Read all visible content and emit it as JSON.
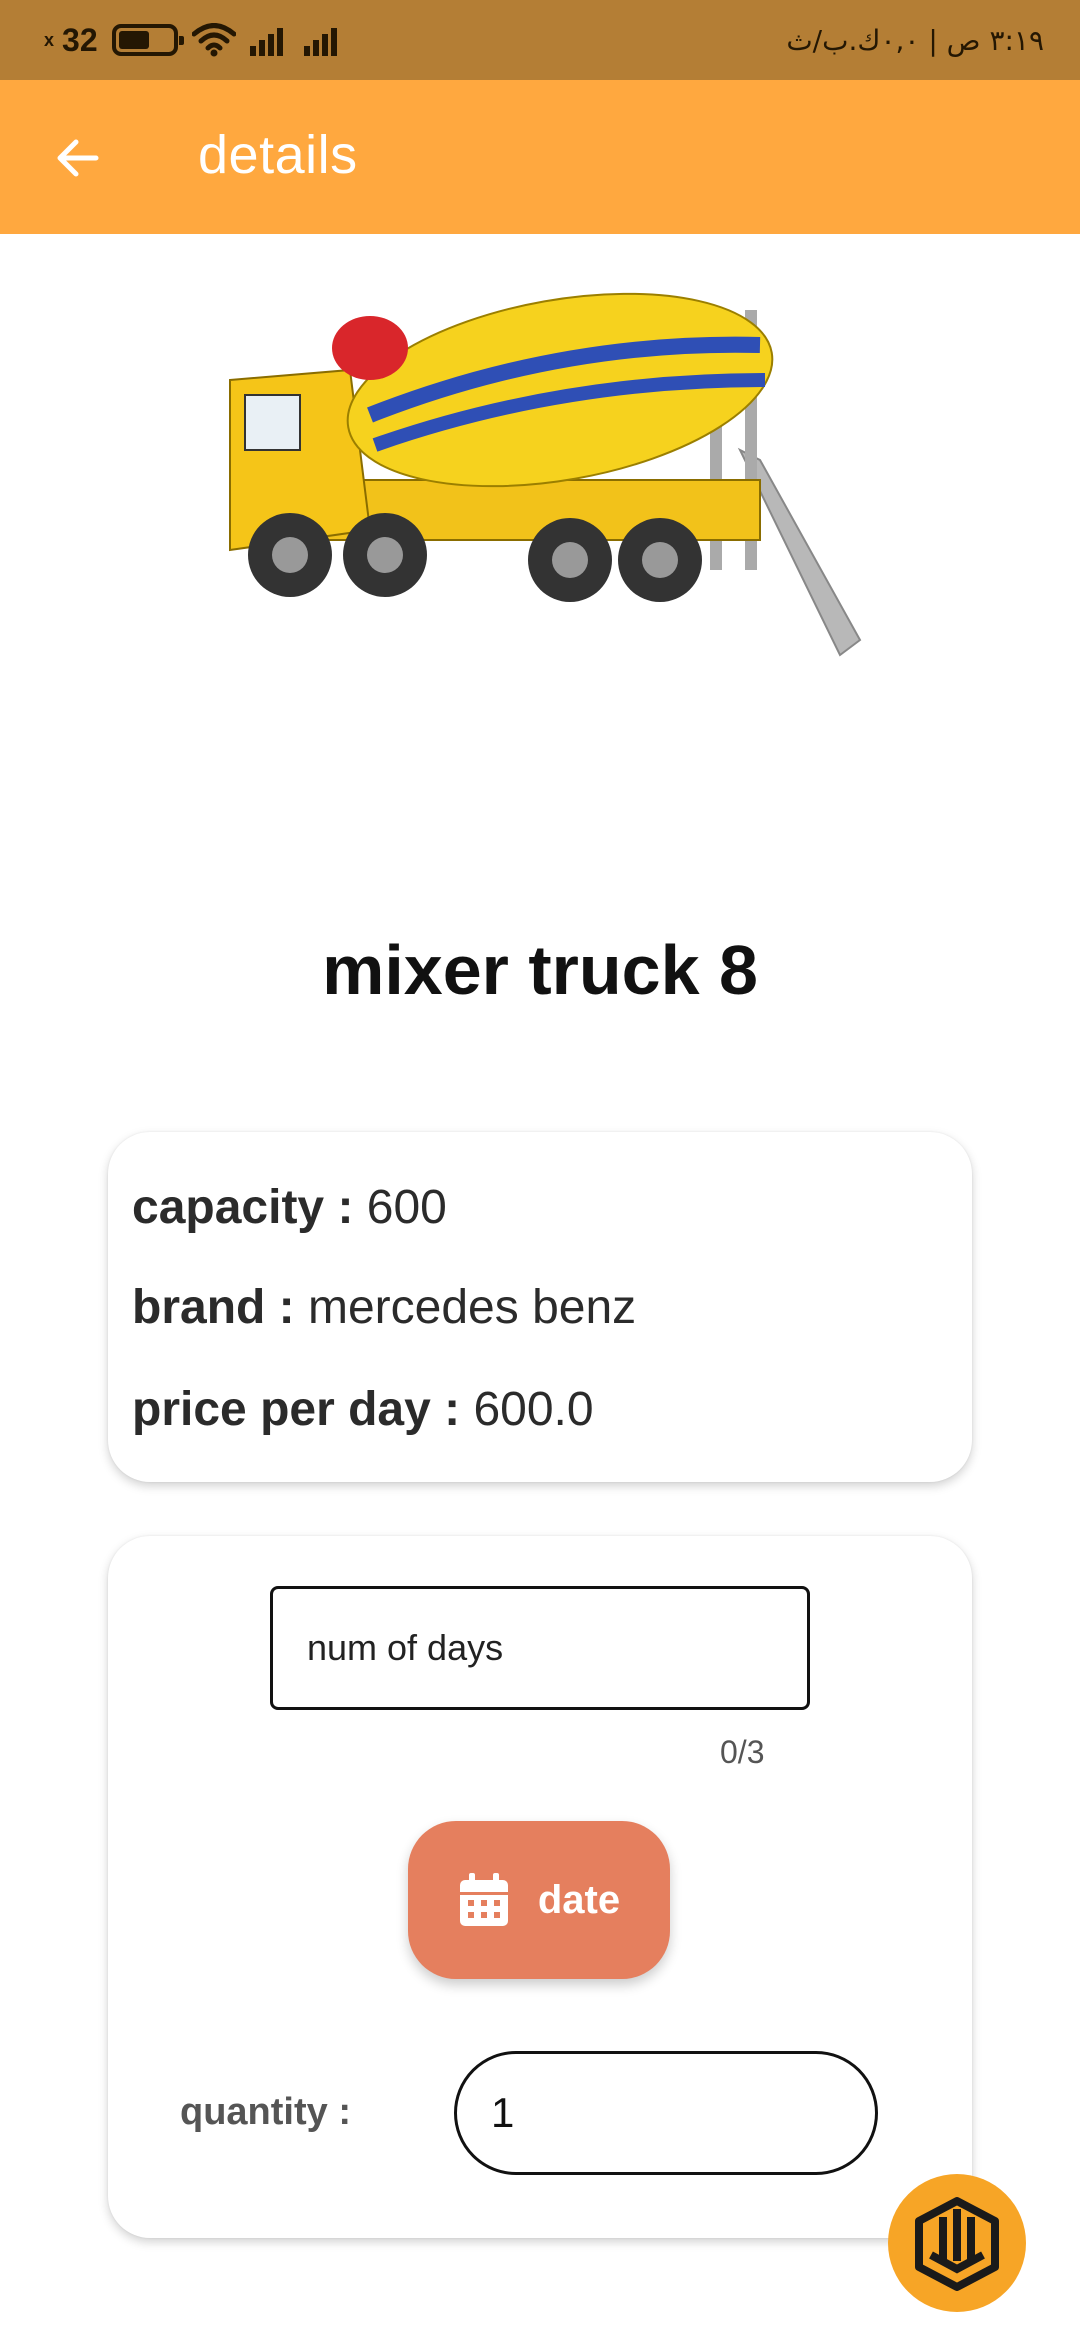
{
  "status_bar": {
    "battery_level": "32",
    "battery_marker": "x",
    "time_text": "٣:١٩ ص | ٠,٠ك.ب/ث"
  },
  "app_bar": {
    "title": "details",
    "back_icon": "arrow-left-icon"
  },
  "product": {
    "name": "mixer truck 8",
    "image_alt": "mixer truck",
    "capacity_label": "capacity :",
    "capacity_value": "600",
    "brand_label": "brand :",
    "brand_value": "mercedes benz",
    "price_label": "price per day :",
    "price_value": "600.0"
  },
  "booking": {
    "days_placeholder": "num of days",
    "days_counter": "0/3",
    "date_button_label": "date",
    "date_icon": "calendar-icon",
    "quantity_label": "quantity :",
    "quantity_value": "1"
  },
  "colors": {
    "status_bar": "#B47E35",
    "app_bar": "#FFA83F",
    "date_button": "#E57F5E",
    "logo_bg": "#F7A526"
  }
}
